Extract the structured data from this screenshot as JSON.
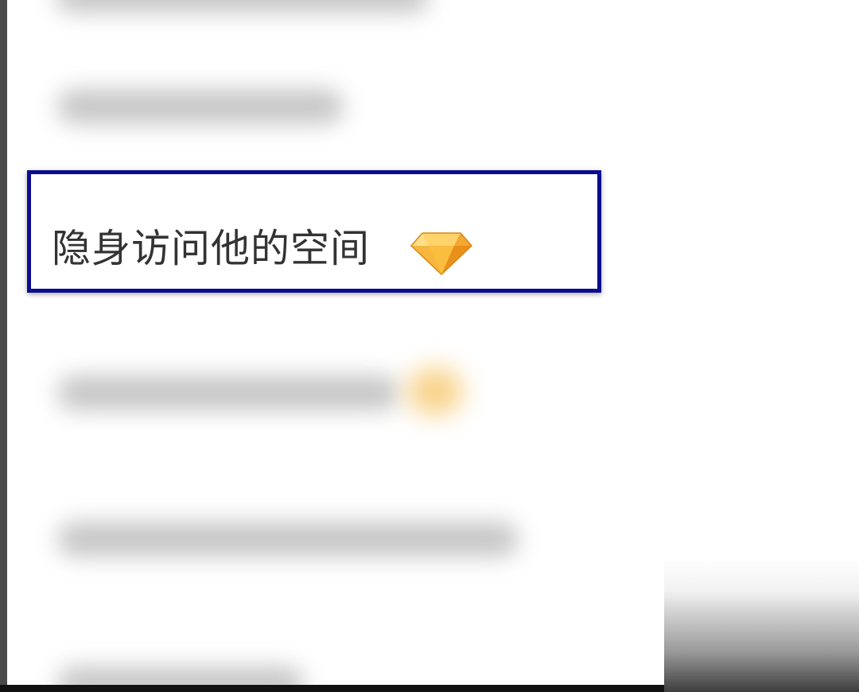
{
  "menu": {
    "highlighted_item": {
      "label": "隐身访问他的空间",
      "badge_icon": "vip-diamond-icon",
      "badge_color": "#f5a623"
    }
  },
  "highlight_color": "#0c0c8f"
}
